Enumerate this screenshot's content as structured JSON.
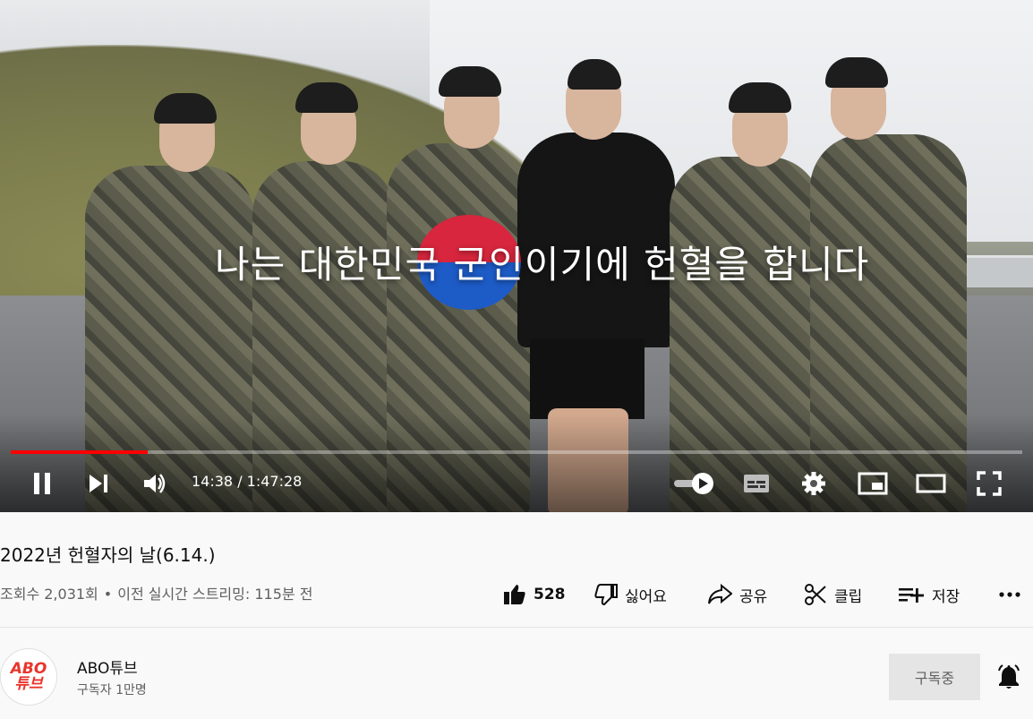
{
  "player": {
    "overlay_text": "나는 대한민국 군인이기에 헌혈을 합니다",
    "current_time": "14:38",
    "separator": " / ",
    "duration": "1:47:28",
    "progress_fraction": 0.1356,
    "progress_color": "#ff0000"
  },
  "video": {
    "title": "2022년 헌혈자의 날(6.14.)",
    "views": "조회수 2,031회",
    "dot": "•",
    "streamed": "이전 실시간 스트리밍: 115분 전"
  },
  "actions": {
    "like_count": "528",
    "dislike_label": "싫어요",
    "share_label": "공유",
    "clip_label": "클립",
    "save_label": "저장"
  },
  "channel": {
    "name": "ABO튜브",
    "subscribers": "구독자 1만명",
    "subscribe_label": "구독중",
    "logo_line1": "ABO",
    "logo_line2": "튜브",
    "logo_color": "#e8352d"
  },
  "icons": [
    "pause-icon",
    "next-icon",
    "volume-icon",
    "autoplay-toggle-icon",
    "subtitles-icon",
    "settings-icon",
    "miniplayer-icon",
    "theater-icon",
    "fullscreen-icon",
    "like-icon",
    "dislike-icon",
    "share-icon",
    "clip-icon",
    "save-icon",
    "more-icon",
    "bell-icon"
  ]
}
